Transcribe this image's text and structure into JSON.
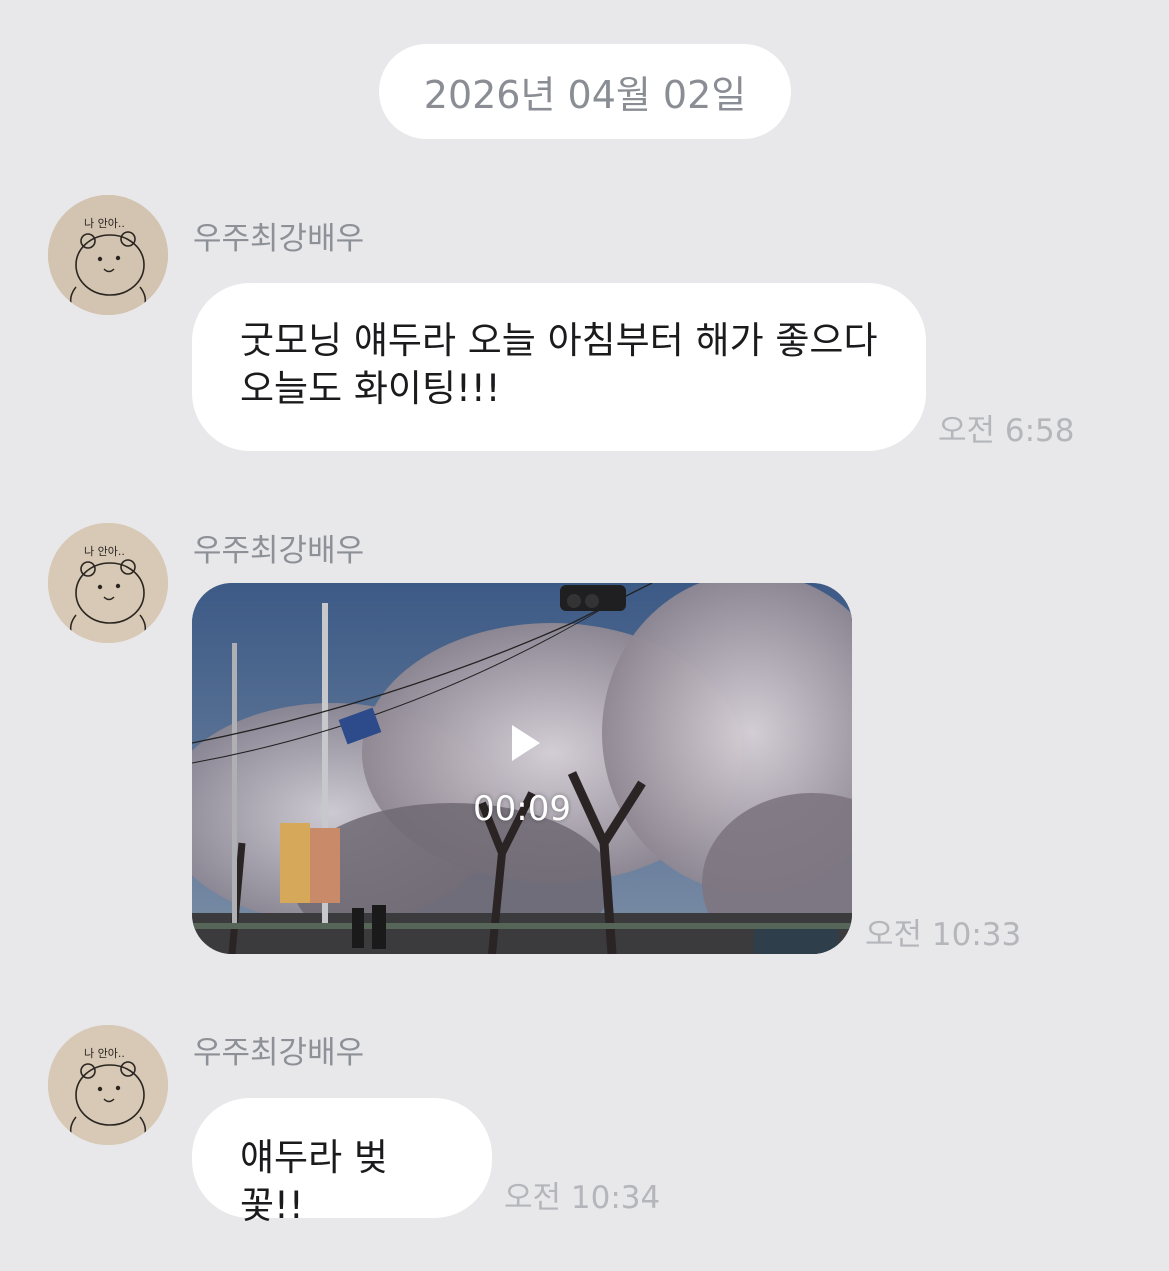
{
  "date_divider": "2026년 04월 02일",
  "messages": [
    {
      "sender": "우주최강배우",
      "text_lines": [
        "굿모닝 얘두라 오늘 아침부터 해가 좋으다",
        "오늘도 화이팅!!!"
      ],
      "time": "오전 6:58"
    },
    {
      "sender": "우주최강배우",
      "video": {
        "duration": "00:09",
        "icon": "play-icon"
      },
      "time": "오전 10:33"
    },
    {
      "sender": "우주최강배우",
      "text": "얘두라 벚꽃!!",
      "time": "오전 10:34"
    }
  ],
  "avatar": {
    "icon": "bear-drawing-avatar",
    "caption": "나 안아.."
  },
  "colors": {
    "background": "#e8e8ea",
    "bubble": "#ffffff",
    "sender_name": "#8e9097",
    "timestamp": "#b4b6bb",
    "date_text": "#8a8d94"
  }
}
